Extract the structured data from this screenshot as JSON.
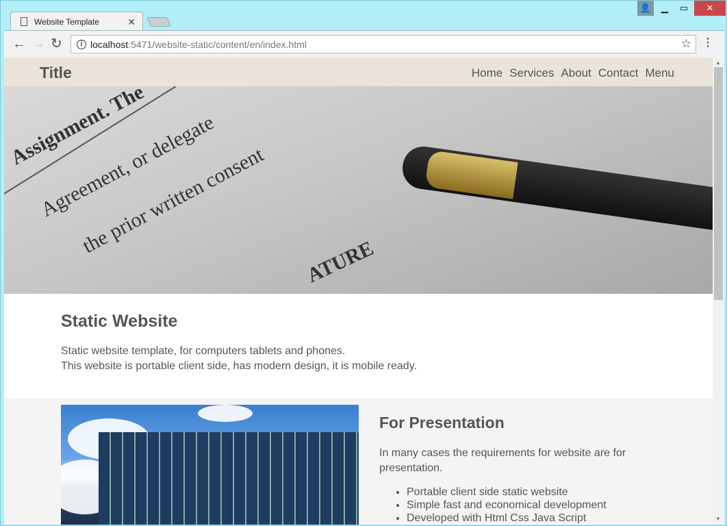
{
  "browser": {
    "tab_title": "Website Template",
    "url_host": "localhost",
    "url_rest": ":5471/website-static/content/en/index.html"
  },
  "site": {
    "title": "Title",
    "nav": [
      "Home",
      "Services",
      "About",
      "Contact",
      "Menu"
    ],
    "hero_text": [
      "Assignment. The",
      "Agreement, or delegate",
      "the prior written consent",
      "ATURE"
    ],
    "intro": {
      "heading": "Static Website",
      "lines": [
        "Static website template, for computers tablets and phones.",
        "This website is portable client side, has modern design, it is mobile ready."
      ]
    },
    "feature": {
      "heading": "For Presentation",
      "text": "In many cases the requirements for website are for presentation.",
      "items": [
        "Portable client side static website",
        "Simple fast and economical development",
        "Developed with Html Css Java Script"
      ]
    }
  }
}
